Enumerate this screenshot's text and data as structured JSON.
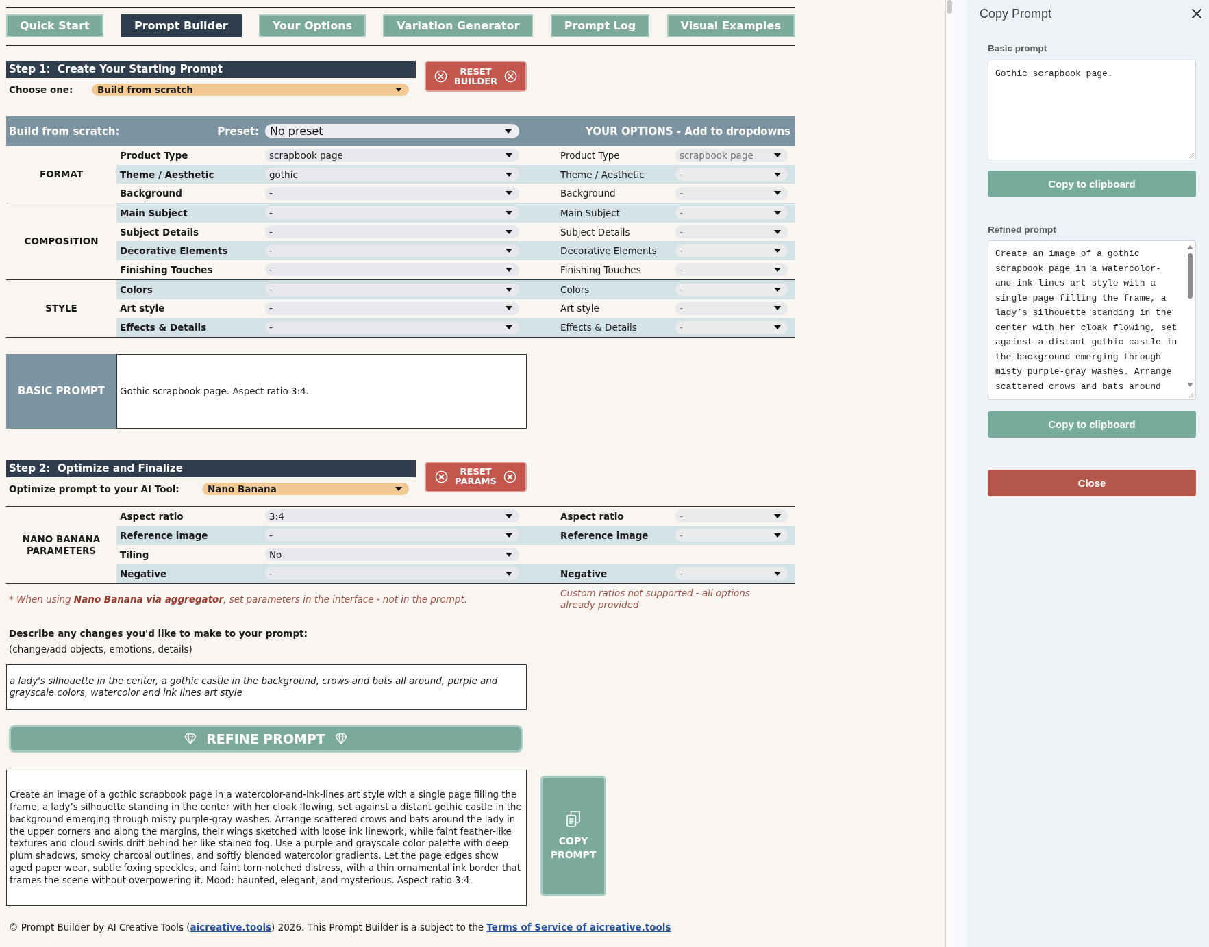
{
  "tabs": [
    {
      "label": "Quick Start",
      "selected": false
    },
    {
      "label": "Prompt Builder",
      "selected": true
    },
    {
      "label": "Your Options",
      "selected": false
    },
    {
      "label": "Variation Generator",
      "selected": false
    },
    {
      "label": "Prompt Log",
      "selected": false
    },
    {
      "label": "Visual Examples",
      "selected": false
    }
  ],
  "step1": {
    "title": "Step 1:  Create Your Starting Prompt",
    "reset_button": "RESET BUILDER",
    "choose_label": "Choose one:",
    "choose_value": "Build from scratch"
  },
  "builder": {
    "title": "Build from scratch:",
    "preset_label": "Preset:",
    "preset_value": "No preset",
    "options_title": "YOUR OPTIONS - Add to dropdowns",
    "groups": [
      {
        "name": "FORMAT",
        "rows": [
          {
            "label": "Product Type",
            "value": "scrapbook page",
            "option_label": "Product Type",
            "option_value": "scrapbook page"
          },
          {
            "label": "Theme / Aesthetic",
            "value": "gothic",
            "option_label": "Theme / Aesthetic",
            "option_value": "-"
          },
          {
            "label": "Background",
            "value": "-",
            "option_label": "Background",
            "option_value": "-"
          }
        ]
      },
      {
        "name": "COMPOSITION",
        "rows": [
          {
            "label": "Main Subject",
            "value": "-",
            "option_label": "Main Subject",
            "option_value": "-"
          },
          {
            "label": "Subject Details",
            "value": "-",
            "option_label": "Subject Details",
            "option_value": "-"
          },
          {
            "label": "Decorative Elements",
            "value": "-",
            "option_label": "Decorative Elements",
            "option_value": "-"
          },
          {
            "label": "Finishing Touches",
            "value": "-",
            "option_label": "Finishing Touches",
            "option_value": "-"
          }
        ]
      },
      {
        "name": "STYLE",
        "rows": [
          {
            "label": "Colors",
            "value": "-",
            "option_label": "Colors",
            "option_value": "-"
          },
          {
            "label": "Art style",
            "value": "-",
            "option_label": "Art style",
            "option_value": "-"
          },
          {
            "label": "Effects & Details",
            "value": "-",
            "option_label": "Effects & Details",
            "option_value": "-"
          }
        ]
      }
    ]
  },
  "basic_prompt": {
    "label": "BASIC PROMPT",
    "text": "Gothic scrapbook page. Aspect ratio 3:4."
  },
  "step2": {
    "title": "Step 2:  Optimize and Finalize",
    "reset_button": "RESET PARAMS",
    "tool_label": "Optimize prompt to your AI Tool:",
    "tool_value": "Nano Banana"
  },
  "parameters": {
    "group": "NANO BANANA PARAMETERS",
    "rows": [
      {
        "label": "Aspect ratio",
        "value": "3:4",
        "option_label": "Aspect ratio",
        "option_value": "-"
      },
      {
        "label": "Reference image",
        "value": "-",
        "option_label": "Reference image",
        "option_value": "-"
      },
      {
        "label": "Tiling",
        "value": "No"
      },
      {
        "label": "Negative",
        "value": "-",
        "option_label": "Negative",
        "option_value": "-"
      }
    ],
    "note": "* When using **Nano Banana via aggregator**, set parameters in the interface - not in the prompt.",
    "options_note": "Custom ratios not supported - all options already provided"
  },
  "changes": {
    "title": "Describe any changes you'd like to make to your prompt:",
    "hint": "(change/add objects, emotions, details)",
    "value": "a lady's silhouette in the center, a gothic castle in the background, crows and bats all around, purple and grayscale colors, watercolor and ink lines art style"
  },
  "refine_button": "REFINE PROMPT",
  "result": {
    "text": "Create an image of a gothic scrapbook page in a watercolor-and-ink-lines art style with a single page filling the frame, a lady’s silhouette standing in the center with her cloak flowing, set against a distant gothic castle in the background emerging through misty purple-gray washes. Arrange scattered crows and bats around the lady in the upper corners and along the margins, their wings sketched with loose ink linework, while faint feather-like textures and cloud swirls drift behind her like stained fog. Use a purple and grayscale color palette with deep plum shadows, smoky charcoal outlines, and softly blended watercolor gradients. Let the page edges show aged paper wear, subtle foxing speckles, and faint torn-notched distress, with a thin ornamental ink border that frames the scene without overpowering it. Mood: haunted, elegant, and mysterious. Aspect ratio 3:4.",
    "copy_button": "COPY PROMPT"
  },
  "footer": {
    "segments": [
      {
        "kind": "text",
        "text": "© Prompt Builder by AI Creative Tools ("
      },
      {
        "kind": "link",
        "text": "aicreative.tools"
      },
      {
        "kind": "text",
        "text": ") 2026. This Prompt Builder is a subject to the "
      },
      {
        "kind": "link",
        "text": "Terms of Service of aicreative.tools"
      }
    ]
  },
  "panel": {
    "title": "Copy Prompt",
    "fields": [
      {
        "kind": "plain",
        "label": "Basic prompt",
        "text": "Gothic scrapbook page.",
        "button": "Copy to clipboard"
      },
      {
        "kind": "scrolling",
        "label": "Refined prompt",
        "text": "Create an image of a gothic scrapbook page in a watercolor-and-ink-lines art style with a single page filling the frame, a lady’s silhouette standing in the center with her cloak flowing, set against a distant gothic castle in the background emerging through misty purple-gray washes. Arrange scattered crows and bats around",
        "button": "Copy to clipboard"
      }
    ],
    "close_button": "Close"
  }
}
